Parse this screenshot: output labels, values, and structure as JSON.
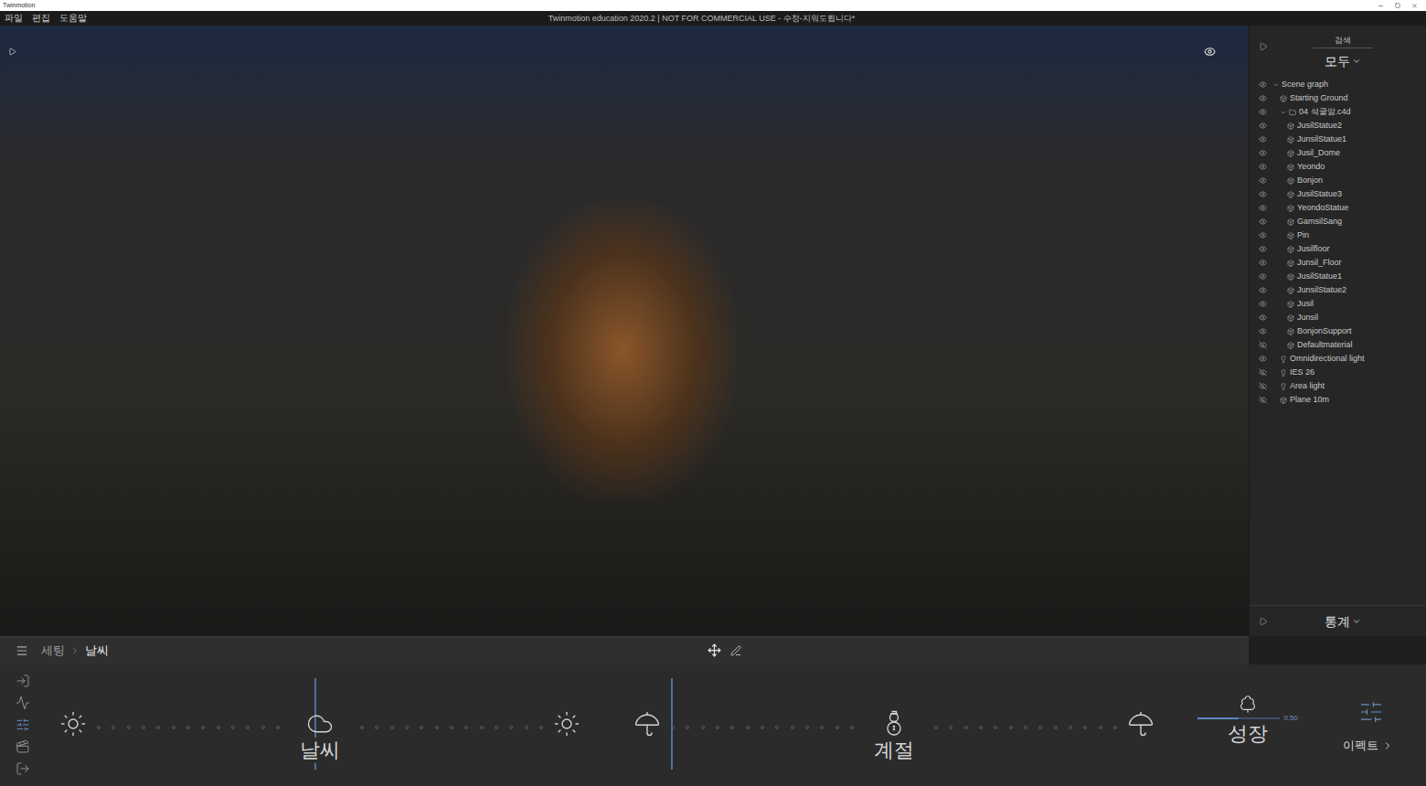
{
  "app": {
    "name": "Twinmotion"
  },
  "window": {
    "title": "Twinmotion education 2020.2 | NOT FOR COMMERCIAL USE - 수정-지워도됩니다*"
  },
  "menu": [
    "파일",
    "편집",
    "도움말"
  ],
  "scene_panel": {
    "search_label": "검색",
    "filter": "모두",
    "footer": "통계",
    "items": [
      {
        "label": "Scene graph",
        "depth": 0,
        "kind": "root",
        "visible": true,
        "expanded": true
      },
      {
        "label": "Starting Ground",
        "depth": 1,
        "kind": "object",
        "visible": true
      },
      {
        "label": "04 석굴암.c4d",
        "depth": 1,
        "kind": "folder",
        "visible": true,
        "expanded": true
      },
      {
        "label": "JusilStatue2",
        "depth": 2,
        "kind": "object",
        "visible": true
      },
      {
        "label": "JunsilStatue1",
        "depth": 2,
        "kind": "object",
        "visible": true
      },
      {
        "label": "Jusil_Dome",
        "depth": 2,
        "kind": "object",
        "visible": true
      },
      {
        "label": "Yeondo",
        "depth": 2,
        "kind": "object",
        "visible": true
      },
      {
        "label": "Bonjon",
        "depth": 2,
        "kind": "object",
        "visible": true
      },
      {
        "label": "JusilStatue3",
        "depth": 2,
        "kind": "object",
        "visible": true
      },
      {
        "label": "YeondoStatue",
        "depth": 2,
        "kind": "object",
        "visible": true
      },
      {
        "label": "GamsilSang",
        "depth": 2,
        "kind": "object",
        "visible": true
      },
      {
        "label": "Pin",
        "depth": 2,
        "kind": "object",
        "visible": true
      },
      {
        "label": "Jusilfloor",
        "depth": 2,
        "kind": "object",
        "visible": true
      },
      {
        "label": "Junsil_Floor",
        "depth": 2,
        "kind": "object",
        "visible": true
      },
      {
        "label": "JusilStatue1",
        "depth": 2,
        "kind": "object",
        "visible": true
      },
      {
        "label": "JunsilStatue2",
        "depth": 2,
        "kind": "object",
        "visible": true
      },
      {
        "label": "Jusil",
        "depth": 2,
        "kind": "object",
        "visible": true
      },
      {
        "label": "Junsil",
        "depth": 2,
        "kind": "object",
        "visible": true
      },
      {
        "label": "BonjonSupport",
        "depth": 2,
        "kind": "object",
        "visible": true
      },
      {
        "label": "Defaultmaterial",
        "depth": 2,
        "kind": "object",
        "visible": false
      },
      {
        "label": "Omnidirectional light",
        "depth": 1,
        "kind": "light",
        "visible": true
      },
      {
        "label": "IES 26",
        "depth": 1,
        "kind": "light",
        "visible": false
      },
      {
        "label": "Area light",
        "depth": 1,
        "kind": "light",
        "visible": false
      },
      {
        "label": "Plane 10m",
        "depth": 1,
        "kind": "object",
        "visible": false
      }
    ]
  },
  "breadcrumb": [
    "세팅",
    "날씨"
  ],
  "tools": [
    {
      "kind": "import",
      "selected": false
    },
    {
      "kind": "path",
      "selected": false
    },
    {
      "kind": "settings",
      "selected": true
    },
    {
      "kind": "media",
      "selected": false
    },
    {
      "kind": "export",
      "selected": false
    }
  ],
  "sliders": [
    {
      "kind": "weather",
      "label": "날씨",
      "level": 0.49
    },
    {
      "kind": "season",
      "label": "계절",
      "level": 0.05
    }
  ],
  "growth": {
    "label": "성장",
    "reading": "0.50",
    "level": 0.5
  },
  "effects": {
    "label": "이펙트"
  }
}
